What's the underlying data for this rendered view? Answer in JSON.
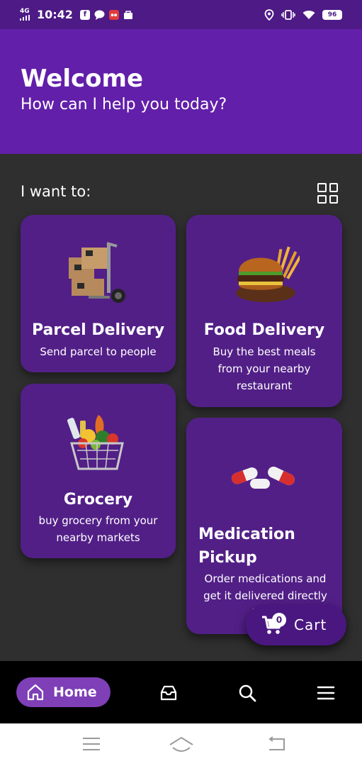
{
  "status_bar": {
    "network": "4G",
    "time": "10:42",
    "battery": "96",
    "icons": [
      "facebook-icon",
      "chat-icon",
      "app-icon",
      "shop-icon",
      "location-icon",
      "vibrate-icon",
      "wifi-icon",
      "battery-icon"
    ]
  },
  "header": {
    "title": "Welcome",
    "subtitle": "How can I help you today?"
  },
  "section": {
    "label": "I want to:"
  },
  "services": {
    "parcel": {
      "title": "Parcel Delivery",
      "desc": "Send parcel to people",
      "icon": "parcel-trolley-image"
    },
    "food": {
      "title": "Food Delivery",
      "desc": "Buy the best meals from your nearby restaurant",
      "icon": "burger-fries-image"
    },
    "grocery": {
      "title": "Grocery",
      "desc": "buy grocery from your nearby markets",
      "icon": "grocery-basket-image"
    },
    "medication": {
      "title": "Medication Pickup",
      "desc": "Order medications and get it delivered directly to yo",
      "icon": "pills-image"
    }
  },
  "cart": {
    "count": "0",
    "label": "Cart"
  },
  "bottom_nav": {
    "home_label": "Home",
    "items": [
      "home-icon",
      "inbox-icon",
      "search-icon",
      "menu-icon"
    ]
  },
  "colors": {
    "header": "#621fa9",
    "status_bar": "#4d1a86",
    "card": "#521f87",
    "background": "#2f2f2f",
    "nav_active": "#7e3fb7"
  }
}
